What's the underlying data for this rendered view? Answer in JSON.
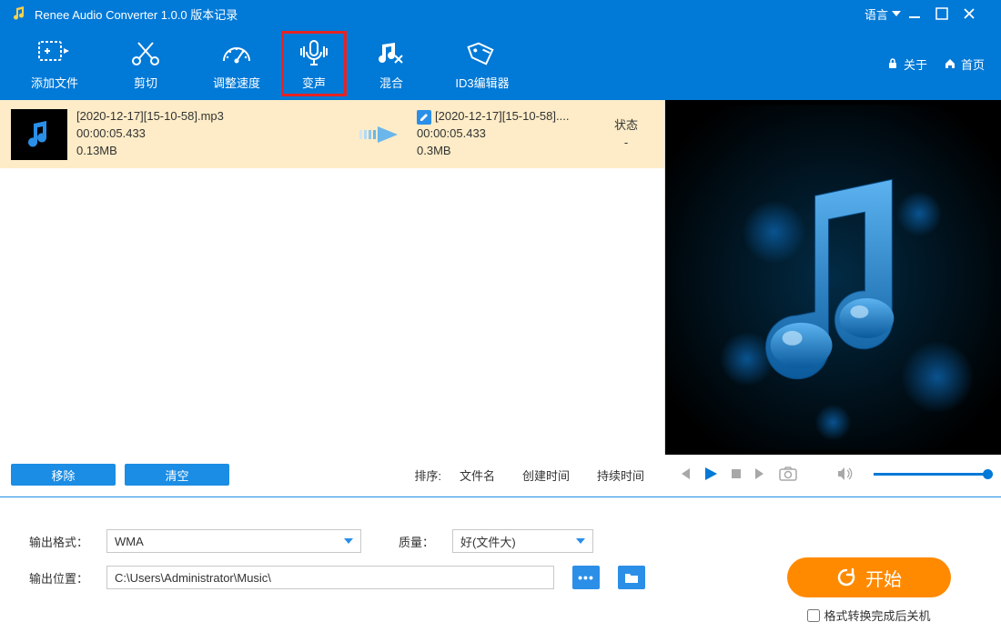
{
  "titlebar": {
    "app_title": "Renee Audio Converter 1.0.0 版本记录",
    "language_label": "语言"
  },
  "toolbar": {
    "items": [
      {
        "label": "添加文件"
      },
      {
        "label": "剪切"
      },
      {
        "label": "调整速度"
      },
      {
        "label": "变声"
      },
      {
        "label": "混合"
      },
      {
        "label": "ID3编辑器"
      }
    ],
    "about": "关于",
    "home": "首页"
  },
  "filelist": {
    "row": {
      "src_name": "[2020-12-17][15-10-58].mp3",
      "src_duration": "00:00:05.433",
      "src_size": "0.13MB",
      "out_name": "[2020-12-17][15-10-58]....",
      "out_duration": "00:00:05.433",
      "out_size": "0.3MB"
    },
    "status_header": "状态",
    "status_value": "-",
    "remove": "移除",
    "clear": "清空",
    "sort_label": "排序:",
    "sort_options": [
      "文件名",
      "创建时间",
      "持续时间"
    ]
  },
  "output": {
    "format_label": "输出格式：",
    "format_value": "WMA",
    "quality_label": "质量：",
    "quality_value": "好(文件大)",
    "path_label": "输出位置：",
    "path_value": "C:\\Users\\Administrator\\Music\\",
    "start_label": "开始",
    "shutdown_label": "格式转换完成后关机"
  },
  "colors": {
    "primary": "#0079d7",
    "accent": "#ff8a00",
    "row_highlight": "#fdecc7"
  }
}
